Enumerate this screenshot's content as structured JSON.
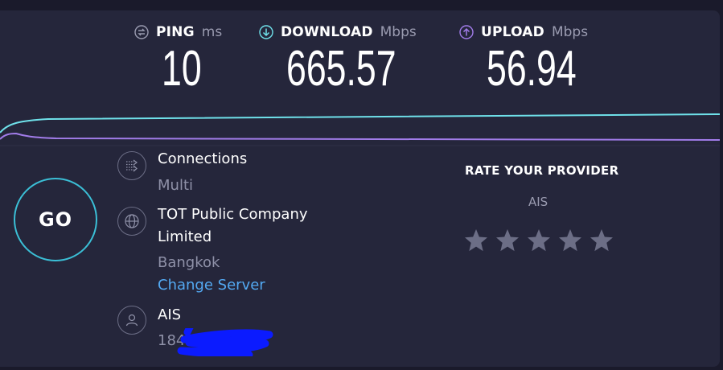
{
  "metrics": {
    "ping": {
      "label": "PING",
      "unit": "ms",
      "value": "10",
      "icon": "ping-icon"
    },
    "download": {
      "label": "DOWNLOAD",
      "unit": "Mbps",
      "value": "665.57",
      "icon": "download-arrow-icon"
    },
    "upload": {
      "label": "UPLOAD",
      "unit": "Mbps",
      "value": "56.94",
      "icon": "upload-arrow-icon"
    }
  },
  "colors": {
    "download": "#6fe1ea",
    "upload": "#a17ce9",
    "go_ring": "#3bbfd6",
    "link": "#53a9f2"
  },
  "go_button": {
    "label": "GO"
  },
  "connections": {
    "label": "Connections",
    "value": "Multi",
    "icon": "connections-icon"
  },
  "server": {
    "name_line1": "TOT Public Company",
    "name_line2": "Limited",
    "location": "Bangkok",
    "change_link": "Change Server",
    "icon": "globe-icon"
  },
  "isp": {
    "name": "AIS",
    "ip_partial": "184",
    "icon": "user-icon"
  },
  "rating": {
    "title": "RATE YOUR PROVIDER",
    "provider": "AIS",
    "stars_total": 5,
    "stars_selected": 0
  }
}
